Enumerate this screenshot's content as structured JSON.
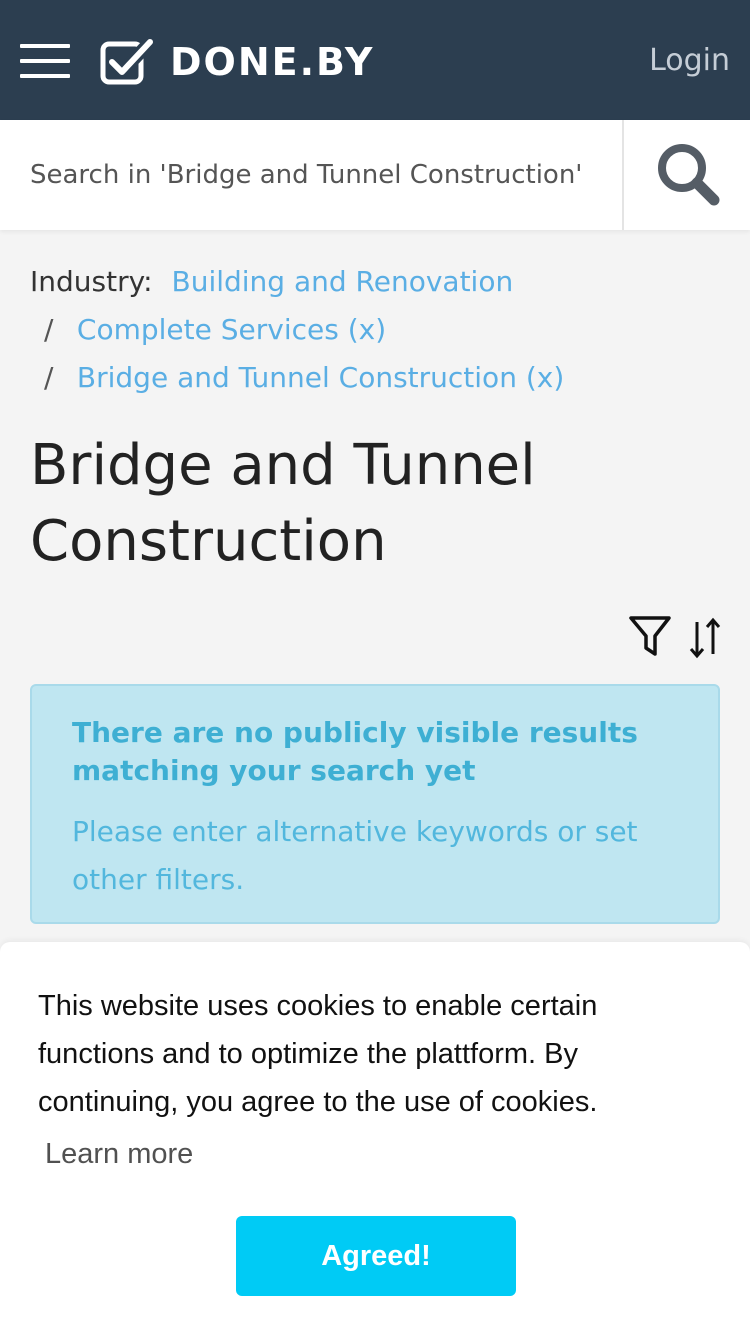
{
  "header": {
    "brand": "DONE.BY",
    "login_label": "Login",
    "menu_icon": "hamburger-menu-icon",
    "logo_icon": "checkbox-check-icon"
  },
  "search": {
    "placeholder": "Search in 'Bridge and Tunnel Construction'",
    "icon": "search-icon"
  },
  "breadcrumb": {
    "label": "Industry:",
    "items": [
      {
        "text": "Building and Renovation",
        "separator": ""
      },
      {
        "text": "Complete Services (x)",
        "separator": "/"
      },
      {
        "text": "Bridge and Tunnel Construction (x)",
        "separator": "/"
      }
    ]
  },
  "page": {
    "title_line1": "Bridge and Tunnel",
    "title_line2": "Construction"
  },
  "tools": {
    "filter_icon": "filter-icon",
    "sort_icon": "sort-icon"
  },
  "alert": {
    "title": "There are no publicly visible results matching your search yet",
    "text": "Please enter alternative keywords or set other filters."
  },
  "cookie": {
    "message": "This website uses cookies to enable certain functions and to optimize the plattform. By continuing, you agree to the use of cookies.",
    "learn_more": "Learn more",
    "agree_label": "Agreed!"
  },
  "colors": {
    "header_bg": "#2c3e50",
    "link": "#5aaee4",
    "alert_bg": "#bfe6f1",
    "alert_text": "#3eafd3",
    "button": "#00cbf5"
  }
}
